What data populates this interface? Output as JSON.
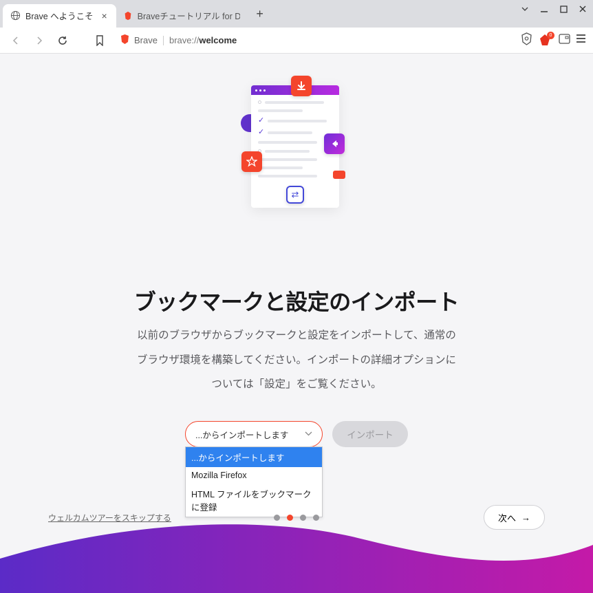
{
  "titlebar": {
    "tab1_title": "Brave へようこそ",
    "tab2_title": "Braveチュートリアル for Desktop"
  },
  "toolbar": {
    "label": "Brave",
    "url_prefix": "brave://",
    "url_bold": "welcome",
    "badge_count": "0"
  },
  "page": {
    "heading": "ブックマークと設定のインポート",
    "description": "以前のブラウザからブックマークと設定をインポートして、通常のブラウザ環境を構築してください。インポートの詳細オプションについては「設定」をご覧ください。",
    "select_placeholder": "...からインポートします",
    "options": [
      "...からインポートします",
      "Mozilla Firefox",
      "HTML ファイルをブックマークに登録"
    ],
    "import_button": "インポート",
    "skip_link": "ウェルカムツアーをスキップする",
    "next_button": "次へ",
    "active_dot_index": 1
  }
}
